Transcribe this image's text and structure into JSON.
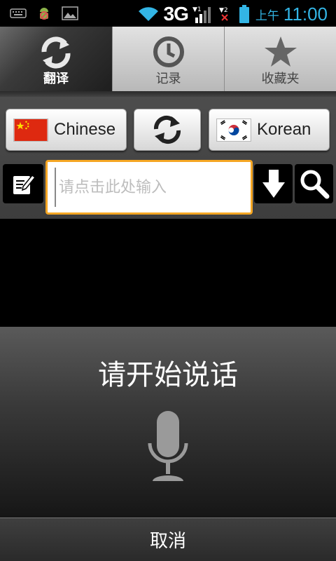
{
  "statusbar": {
    "network": "3G",
    "ampm": "上午",
    "time": "11:00",
    "icons": [
      "keyboard-icon",
      "android-debug-icon",
      "image-icon",
      "wifi-icon",
      "signal-icon",
      "sim2-no-signal-icon",
      "battery-icon"
    ]
  },
  "tabs": [
    {
      "label": "翻译",
      "icon": "refresh-icon",
      "active": true
    },
    {
      "label": "记录",
      "icon": "clock-icon",
      "active": false
    },
    {
      "label": "收藏夹",
      "icon": "star-icon",
      "active": false
    }
  ],
  "languages": {
    "source": {
      "name": "Chinese",
      "flag": "china-flag-icon"
    },
    "swap": {
      "icon": "swap-arrows-icon"
    },
    "target": {
      "name": "Korean",
      "flag": "korea-flag-icon"
    }
  },
  "input": {
    "placeholder": "请点击此处输入",
    "value": ""
  },
  "voice_dialog": {
    "title": "请开始说话",
    "icon": "microphone-icon",
    "cancel_label": "取消"
  },
  "colors": {
    "accent_blue": "#33b5e5",
    "input_border": "#f5a623"
  }
}
